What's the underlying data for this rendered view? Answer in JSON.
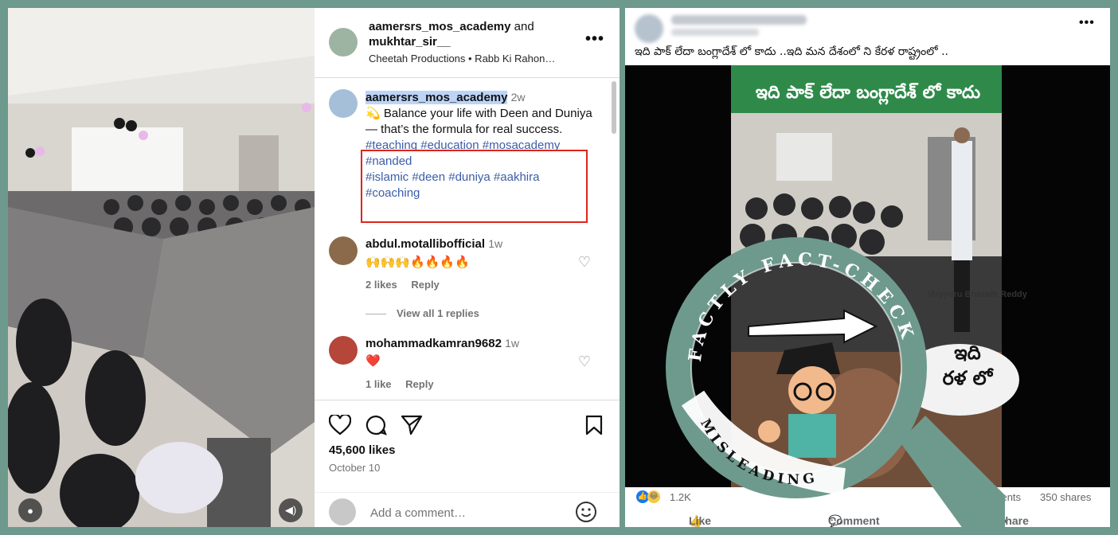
{
  "instagram": {
    "header": {
      "user1": "aamersrs_mos_academy",
      "and": "and",
      "user2": "mukhtar_sir__",
      "sub": "Cheetah Productions • Rabb Ki Rahon…"
    },
    "caption": {
      "user": "aamersrs_mos_academy",
      "time": "2w",
      "text": "💫 Balance your life with Deen and Duniya — that’s the formula for real success.",
      "hashtags_line1": "#teaching #education #mosacademy",
      "hashtags_line2": "#nanded",
      "hashtags_line3": "#islamic #deen #duniya #aakhira",
      "hashtags_line4": "#coaching"
    },
    "comments": [
      {
        "user": "abdul.motallibofficial",
        "time": "1w",
        "text": "🙌🙌🙌🔥🔥🔥🔥",
        "likes": "2 likes",
        "reply": "Reply"
      },
      {
        "user": "mohammadkamran9682",
        "time": "1w",
        "text": "❤️",
        "likes": "1 like",
        "reply": "Reply"
      }
    ],
    "view_replies": "View all 1 replies",
    "likes_count": "45,600 likes",
    "date": "October 10",
    "add_comment_placeholder": "Add a comment…"
  },
  "facebook": {
    "post_text": "ఇది పాక్ లేదా బంగ్లాదేశ్ లో కాదు ..ఇది మన దేశంలో ని కేరళ రాష్ట్రంలో ..",
    "video_banner": "ఇది పాక్ లేదా బంగ్లాదేశ్ లో కాదు",
    "video_watermark": "Vuyyuru Bharath Reddy",
    "video_bubble_line1": "ఇది",
    "video_bubble_line2": "రళ లో",
    "reactions_count": "1.2K",
    "comments_count": "78 comments",
    "shares_count": "350 shares",
    "like_label": "Like",
    "comment_label": "Comment",
    "share_label": "Share"
  },
  "overlay": {
    "seal_top": "FACTLY FACT-CHECK",
    "seal_bottom": "MISLEADING"
  },
  "colors": {
    "background": "#6e9a8d",
    "seal": "#6e9a8d",
    "hashtag": "#3b5da8",
    "highlight_box": "#e0251b"
  }
}
